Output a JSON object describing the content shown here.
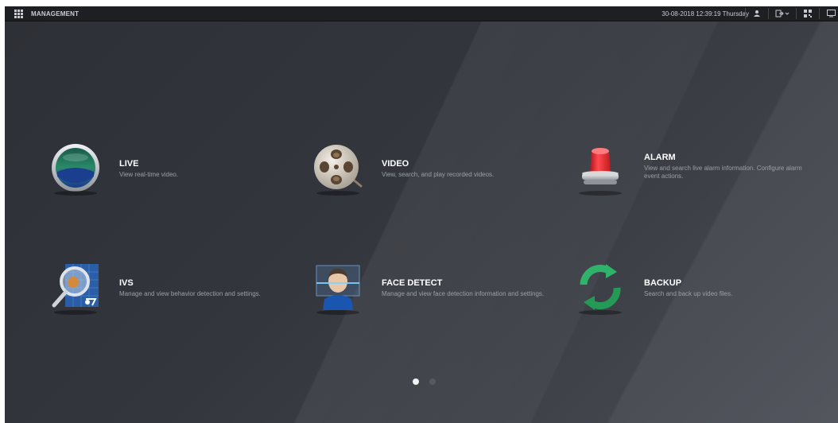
{
  "header": {
    "app_title": "MANAGEMENT",
    "datetime": "30-08-2018 12:39:19 Thursday",
    "icons": [
      "user-icon",
      "logout-icon",
      "qr-code-icon",
      "monitor-icon"
    ]
  },
  "tiles": [
    {
      "title": "LIVE",
      "desc": "View real-time video.",
      "icon": "live-icon"
    },
    {
      "title": "VIDEO",
      "desc": "View, search, and play recorded videos.",
      "icon": "video-reel-icon"
    },
    {
      "title": "ALARM",
      "desc": "View and search live alarm information. Configure alarm event actions.",
      "icon": "alarm-light-icon"
    },
    {
      "title": "IVS",
      "desc": "Manage and view behavior detection and settings.",
      "icon": "ivs-magnifier-icon"
    },
    {
      "title": "FACE DETECT",
      "desc": "Manage and view face detection information and settings.",
      "icon": "face-detect-icon"
    },
    {
      "title": "BACKUP",
      "desc": "Search and back up video files.",
      "icon": "backup-icon"
    }
  ],
  "pagination": {
    "pages": 2,
    "current": 1
  },
  "colors": {
    "alarm_red": "#e8262a",
    "backup_green": "#2fb36a",
    "live_blue": "#1c3f8a"
  }
}
